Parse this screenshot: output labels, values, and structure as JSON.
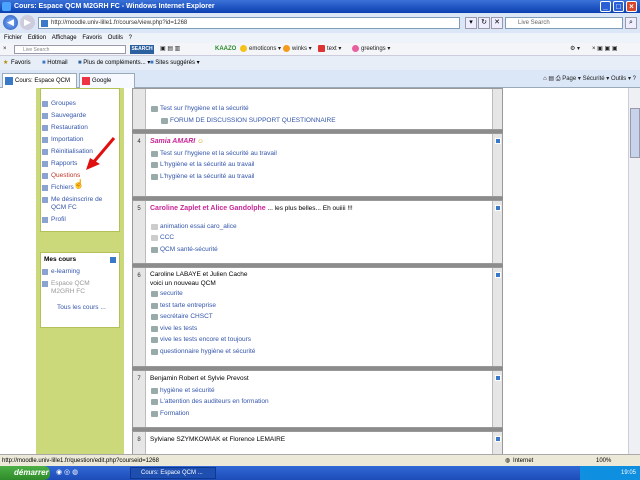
{
  "window": {
    "title": "Cours: Espace QCM M2GRH FC - Windows Internet Explorer"
  },
  "address": {
    "url": "http://moodle.univ-lille1.fr/course/view.php?id=1268",
    "search_placeholder": "Live Search"
  },
  "menu": [
    "Fichier",
    "Edition",
    "Affichage",
    "Favoris",
    "Outils",
    "?"
  ],
  "toolbar": {
    "search_placeholder": "Live Search",
    "search_button": "SEARCH",
    "items": [
      "emoticons",
      "winks",
      "text",
      "greetings"
    ]
  },
  "favorites": {
    "label": "Favoris",
    "items": [
      "Hotmail",
      "Plus de compléments...",
      "Sites suggérés"
    ]
  },
  "tabs": [
    {
      "label": "Cours: Espace QCM M2G..."
    },
    {
      "label": "Google"
    }
  ],
  "commandbar": {
    "page": "Page",
    "security": "Sécurité",
    "tools": "Outils"
  },
  "admin_links": [
    "Groupes",
    "Sauvegarde",
    "Restauration",
    "Importation",
    "Réinitialisation",
    "Rapports",
    "Questions",
    "Fichiers",
    "Me désinscrire de QCM FC",
    "Profil"
  ],
  "mescours": {
    "title": "Mes cours",
    "items": [
      "e-learning",
      "Espace QCM M2GRH FC"
    ],
    "all": "Tous les cours ..."
  },
  "sections": [
    {
      "num": "",
      "lines": [
        {
          "type": "link",
          "text": "Test sur l'hygiène et la sécurité"
        },
        {
          "type": "link",
          "text": "FORUM DE DISCUSSION SUPPORT QUESTIONNAIRE"
        }
      ]
    },
    {
      "num": "4",
      "heading": "Samia AMARI",
      "lines": [
        {
          "type": "link",
          "text": "Test sur l'hygiene et la sécurité au travail"
        },
        {
          "type": "link",
          "text": "L'hygiène et la sécurité au travail"
        },
        {
          "type": "link",
          "text": "L'hygiène et la sécurité au travail"
        }
      ]
    },
    {
      "num": "5",
      "heading": "Caroline Zaplet et Alice Gandolphe",
      "heading_suffix": "... les plus belles... Eh ouiiii !!!",
      "lines": [
        {
          "type": "link",
          "text": "animation essai caro_alice"
        },
        {
          "type": "link",
          "text": "CCC"
        },
        {
          "type": "link",
          "text": "QCM santé-sécurité"
        }
      ]
    },
    {
      "num": "6",
      "text": [
        "Caroline LABAYE et Julien Cache",
        "voici un nouveau QCM"
      ],
      "lines": [
        {
          "type": "link",
          "text": "securite"
        },
        {
          "type": "link",
          "text": "test tarte entreprise"
        },
        {
          "type": "link",
          "text": "secrétaire CHSCT"
        },
        {
          "type": "link",
          "text": "vive les tests"
        },
        {
          "type": "link",
          "text": "vive les tests encore et toujours"
        },
        {
          "type": "link",
          "text": "questionnaire hygiène et sécurité"
        }
      ]
    },
    {
      "num": "7",
      "text": [
        "Benjamin Robert et Sylvie Prevost"
      ],
      "lines": [
        {
          "type": "link",
          "text": "hygiène et sécurité"
        },
        {
          "type": "link",
          "text": "L'attention des auditeurs en formation"
        },
        {
          "type": "link",
          "text": "Formation"
        }
      ]
    },
    {
      "num": "8",
      "text": [
        "Sylviane SZYMKOWIAK et Florence LEMAIRE"
      ],
      "lines": []
    }
  ],
  "status": {
    "url": "http://moodle.univ-lille1.fr/question/edit.php?courseid=1268",
    "zone": "Internet",
    "zoom": "100%"
  },
  "taskbar": {
    "start": "démarrer",
    "task": "Cours: Espace QCM ...",
    "time": "19:05"
  },
  "colors": {
    "link": "#3355aa",
    "sidebar": "#ccd97a",
    "pink": "#c82796"
  }
}
